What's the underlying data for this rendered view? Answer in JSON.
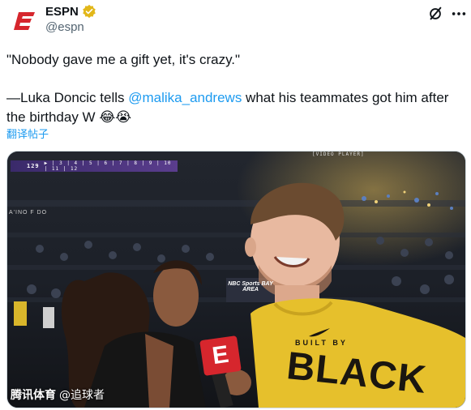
{
  "author": {
    "display_name": "ESPN",
    "handle": "@espn",
    "avatar_icon": "espn-logo-icon",
    "verified_icon": "verified-gold-badge-icon",
    "brand_color": "#d6262d"
  },
  "header_actions": {
    "grok_icon": "grok-icon",
    "more_icon": "more-icon"
  },
  "tweet": {
    "line1": "\"Nobody gave me a gift yet, it's crazy.\"",
    "line2_prefix": "—Luka Doncic tells ",
    "mention": "@malika_andrews",
    "line2_suffix": " what his teammates got him after the birthday W ",
    "emoji1": "😂",
    "emoji2": "😭",
    "mention_color": "#1d9bf0"
  },
  "translate_label": "翻译帖子",
  "media": {
    "score_number": "129",
    "score_rest": "▶ | 3 | 4 | 5 | 6 | 7 | 8 | 9 | 10 | 11 | 12",
    "video_label": "[VIDEO PLAYER]",
    "side_sign": "A'INO F DO",
    "arena_sign": "NBC Sports BAY AREA",
    "mic_letter": "E",
    "jersey_small": "BUILT BY",
    "jersey_big": "BLACK",
    "watermark_brand": "腾讯体育",
    "watermark_user": "@追球者"
  }
}
